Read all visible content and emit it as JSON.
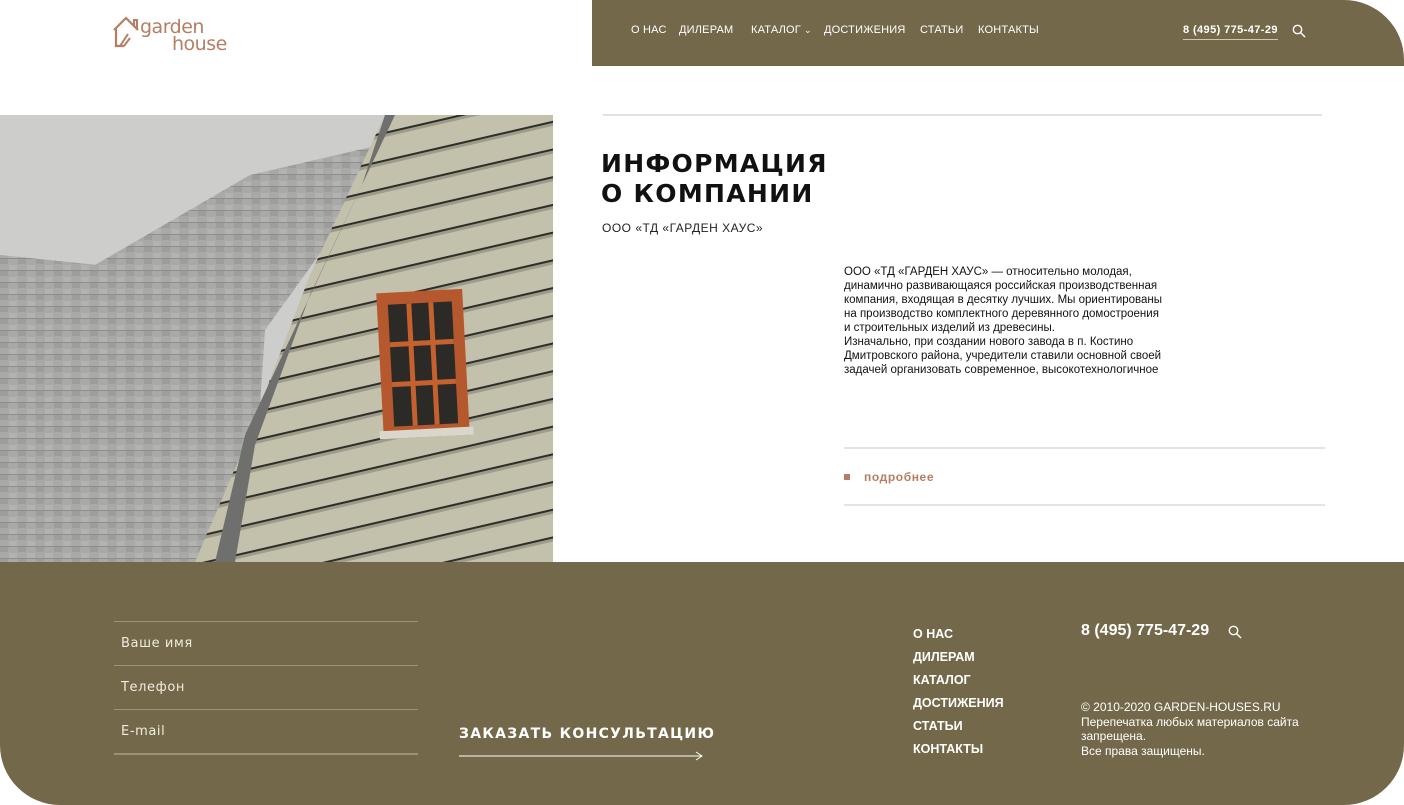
{
  "logo": {
    "line1": "garden",
    "line2": "house"
  },
  "nav": {
    "items": [
      "О НАС",
      "ДИЛЕРАМ",
      "КАТАЛОГ",
      "ДОСТИЖЕНИЯ",
      "СТАТЬИ",
      "КОНТАКТЫ"
    ],
    "catalog_dropdown_icon": "chevron-down-icon",
    "phone": "8 (495) 775-47-29",
    "search_icon": "search-icon"
  },
  "about": {
    "title_line1": "ИНФОРМАЦИЯ",
    "title_line2": "О КОМПАНИИ",
    "subtitle": "ООО «ТД «ГАРДЕН ХАУС»",
    "paragraph1": "ООО «ТД «ГАРДЕН ХАУС» — относительно молодая, динамично развивающаяся российская производственная компания, входящая в десятку лучших. Мы ориентированы на производство комплектного деревянного домостроения и строительных изделий из древесины.",
    "paragraph2": "Изначально, при создании нового завода в п. Костино Дмитровского района, учредители ставили основной своей задачей организовать современное, высокотехнологичное",
    "more_label": "подробнее"
  },
  "footer": {
    "form": {
      "name_placeholder": "Ваше имя",
      "phone_placeholder": "Телефон",
      "email_placeholder": "E-mail",
      "submit_label": "ЗАКАЗАТЬ КОНСУЛЬТАЦИЮ"
    },
    "nav": [
      "О НАС",
      "ДИЛЕРАМ",
      "КАТАЛОГ",
      "ДОСТИЖЕНИЯ",
      "СТАТЬИ",
      "КОНТАКТЫ"
    ],
    "phone": "8 (495) 775-47-29",
    "copyright_lines": [
      "© 2010-2020 GARDEN-HOUSES.RU",
      "Перепечатка любых материалов сайта запрещена.",
      "Все права защищены."
    ]
  },
  "colors": {
    "brand_olive": "#736849",
    "accent_copper": "#b57e62"
  }
}
